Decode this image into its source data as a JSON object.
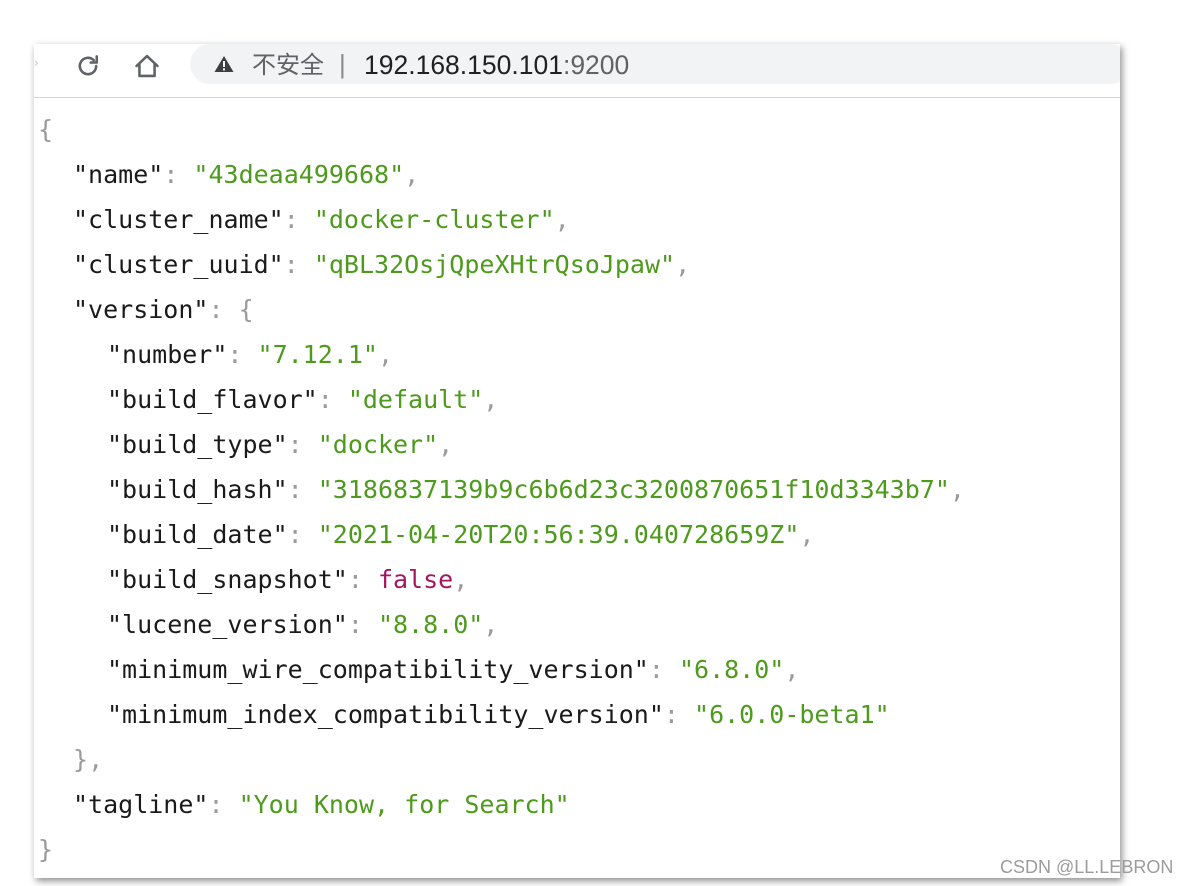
{
  "browser": {
    "security_label": "不安全",
    "separator": "|",
    "url_host": "192.168.150.101",
    "url_port": ":9200",
    "icons": [
      "reload-icon",
      "home-icon",
      "warning-icon"
    ]
  },
  "json_view": {
    "open_brace": "{",
    "close_brace": "}",
    "name_key": "\"name\"",
    "name_value": "\"43deaa499668\"",
    "cluster_name_key": "\"cluster_name\"",
    "cluster_name_value": "\"docker-cluster\"",
    "cluster_uuid_key": "\"cluster_uuid\"",
    "cluster_uuid_value": "\"qBL32OsjQpeXHtrQsoJpaw\"",
    "version_key": "\"version\"",
    "version_open": "{",
    "version_close": "}",
    "number_key": "\"number\"",
    "number_value": "\"7.12.1\"",
    "build_flavor_key": "\"build_flavor\"",
    "build_flavor_value": "\"default\"",
    "build_type_key": "\"build_type\"",
    "build_type_value": "\"docker\"",
    "build_hash_key": "\"build_hash\"",
    "build_hash_value": "\"3186837139b9c6b6d23c3200870651f10d3343b7\"",
    "build_date_key": "\"build_date\"",
    "build_date_value": "\"2021-04-20T20:56:39.040728659Z\"",
    "build_snapshot_key": "\"build_snapshot\"",
    "build_snapshot_value": "false",
    "lucene_version_key": "\"lucene_version\"",
    "lucene_version_value": "\"8.8.0\"",
    "min_wire_key": "\"minimum_wire_compatibility_version\"",
    "min_wire_value": "\"6.8.0\"",
    "min_index_key": "\"minimum_index_compatibility_version\"",
    "min_index_value": "\"6.0.0-beta1\"",
    "tagline_key": "\"tagline\"",
    "tagline_value": "\"You Know, for Search\""
  },
  "colors": {
    "key": "#1a1a1a",
    "string": "#4d9a1c",
    "boolean": "#a3175f",
    "punctuation": "#9a9a9a"
  },
  "watermark": "CSDN @LL.LEBRON"
}
